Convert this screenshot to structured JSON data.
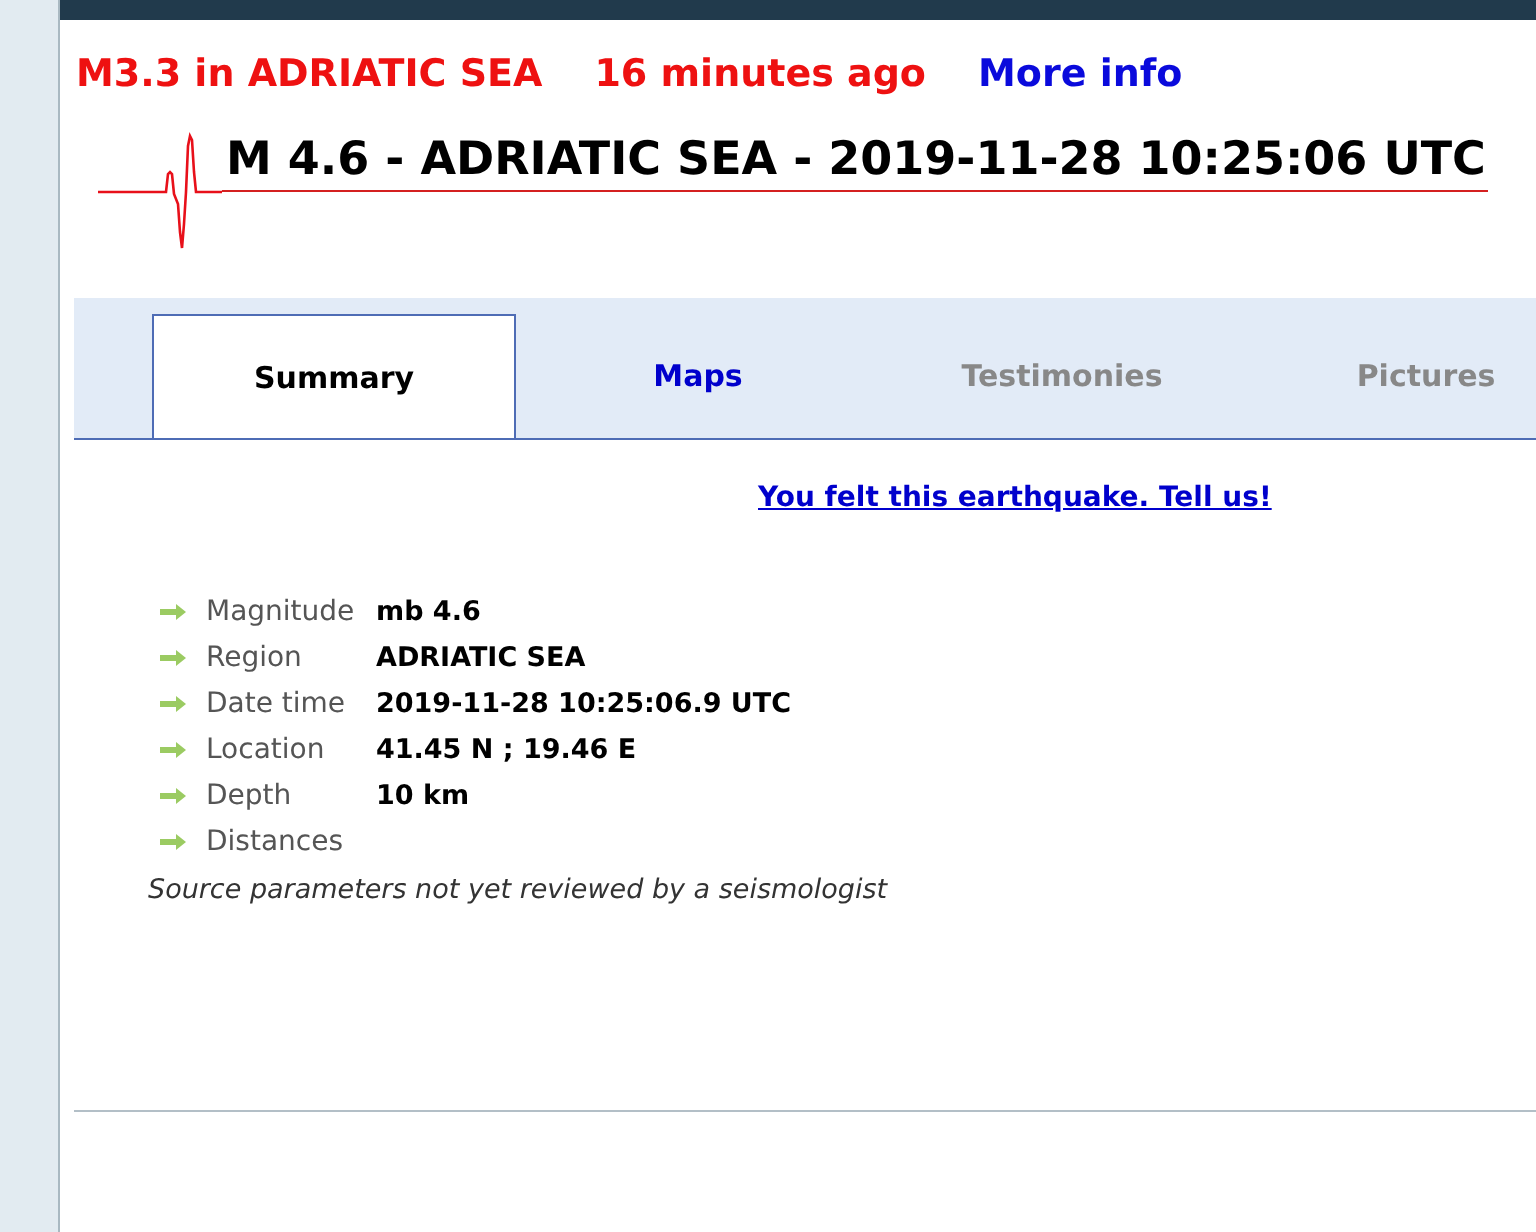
{
  "alert": {
    "headline": "M3.3 in ADRIATIC SEA",
    "time_ago": "16 minutes ago",
    "link": "More info"
  },
  "event_title": "M 4.6 - ADRIATIC SEA - 2019-11-28 10:25:06 UTC",
  "tabs": [
    {
      "label": "Summary",
      "selected": true,
      "disabled": false
    },
    {
      "label": "Maps",
      "selected": false,
      "disabled": false
    },
    {
      "label": "Testimonies",
      "selected": false,
      "disabled": true
    },
    {
      "label": "Pictures",
      "selected": false,
      "disabled": true
    }
  ],
  "felt_link": "You felt this earthquake. Tell us!",
  "details": [
    {
      "label": "Magnitude",
      "value": "mb 4.6"
    },
    {
      "label": "Region",
      "value": "ADRIATIC SEA"
    },
    {
      "label": "Date time",
      "value": "2019-11-28 10:25:06.9 UTC"
    },
    {
      "label": "Location",
      "value": "41.45 N ; 19.46 E"
    },
    {
      "label": "Depth",
      "value": "10 km"
    },
    {
      "label": "Distances"
    }
  ],
  "review_note": "Source parameters not yet reviewed by a seismologist"
}
